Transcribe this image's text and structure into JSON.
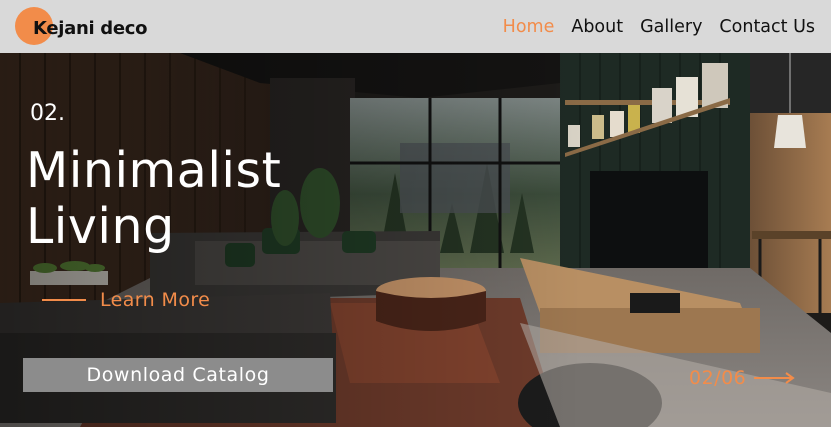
{
  "brand": {
    "name": "Kejani deco"
  },
  "nav": {
    "items": [
      {
        "label": "Home",
        "active": true
      },
      {
        "label": "About",
        "active": false
      },
      {
        "label": "Gallery",
        "active": false
      },
      {
        "label": "Contact Us",
        "active": false
      }
    ]
  },
  "hero": {
    "slide_number": "02.",
    "title_line1": "Minimalist",
    "title_line2": "Living",
    "learn_more": "Learn More",
    "download_label": "Download Catalog",
    "counter": "02/06"
  },
  "colors": {
    "accent": "#f28c4a",
    "header_bg": "#d9d9d9",
    "button_bg": "#8c8c8c",
    "text_light": "#ffffff",
    "text_dark": "#111111"
  },
  "icons": {
    "arrow": "arrow-right-icon",
    "logo_mark": "orange-circle-logo"
  }
}
